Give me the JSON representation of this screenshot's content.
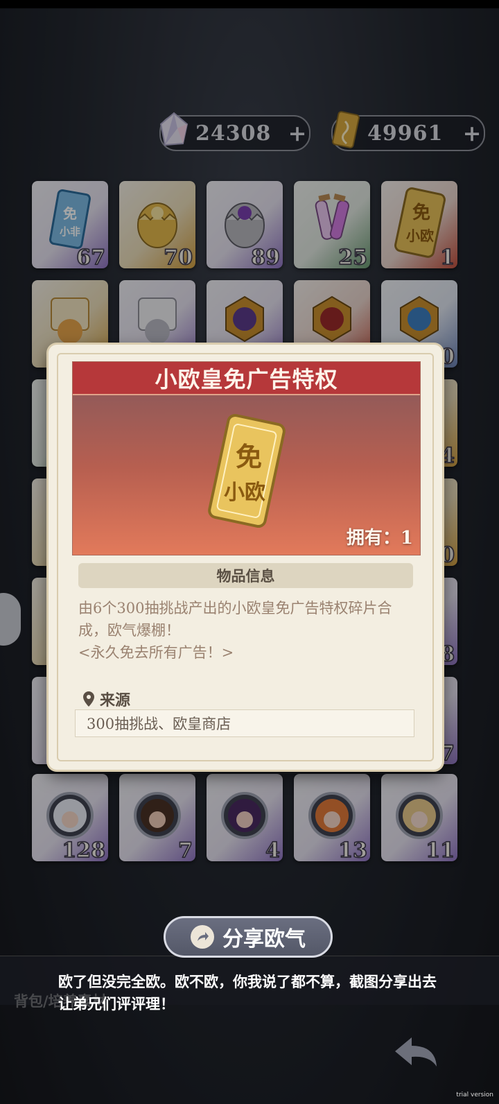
{
  "currencies": [
    {
      "icon": "crystal-icon",
      "value": "24308",
      "plus": "+"
    },
    {
      "icon": "ticket-icon",
      "value": "49961",
      "plus": "+"
    }
  ],
  "inventory": {
    "row1": [
      {
        "icon": "ticket-xiaofei-icon",
        "count": "67",
        "rarity": "purple"
      },
      {
        "icon": "gold-egg-icon",
        "count": "70",
        "rarity": "gold"
      },
      {
        "icon": "purple-egg-icon",
        "count": "89",
        "rarity": "purple"
      },
      {
        "icon": "potion-icon",
        "count": "25",
        "rarity": "green"
      },
      {
        "icon": "ticket-xiaoou-icon",
        "count": "1",
        "rarity": "red"
      }
    ],
    "row2": [
      {
        "icon": "gold-scroll-icon",
        "count": "",
        "rarity": "gold"
      },
      {
        "icon": "silver-scroll-icon",
        "count": "",
        "rarity": "purple"
      },
      {
        "icon": "purple-emblem-icon",
        "count": "",
        "rarity": "purple"
      },
      {
        "icon": "red-emblem-icon",
        "count": "",
        "rarity": "red"
      },
      {
        "icon": "blue-emblem-icon",
        "count": "0",
        "rarity": "blue"
      }
    ],
    "right_counts": [
      "4",
      "0",
      "8",
      "7"
    ],
    "bottom_row": [
      {
        "icon": "portrait-white-hair-icon",
        "count": "128"
      },
      {
        "icon": "portrait-brown-hair-icon",
        "count": "7"
      },
      {
        "icon": "portrait-purple-hair-icon",
        "count": "4"
      },
      {
        "icon": "portrait-orange-hair-icon",
        "count": "13"
      },
      {
        "icon": "portrait-blonde-hair-icon",
        "count": "11"
      }
    ]
  },
  "modal": {
    "title": "小欧皇免广告特权",
    "item_icon": "ticket-xiaoou-icon",
    "owned": "拥有：1",
    "info_header": "物品信息",
    "description_1": "由6个300抽挑战产出的小欧皇免广告特权碎片合成，欧气爆棚！",
    "description_2": "<永久免去所有广告！>",
    "source_label": "来源",
    "source_value": "300抽挑战、欧皇商店"
  },
  "share": {
    "button_label": "分享欧气",
    "message": "欧了但没完全欧。欧不欧，你我说了都不算，截图分享出去让弟兄们评评理！"
  },
  "bag_label": "背包/培养素材",
  "watermark": "trial version"
}
